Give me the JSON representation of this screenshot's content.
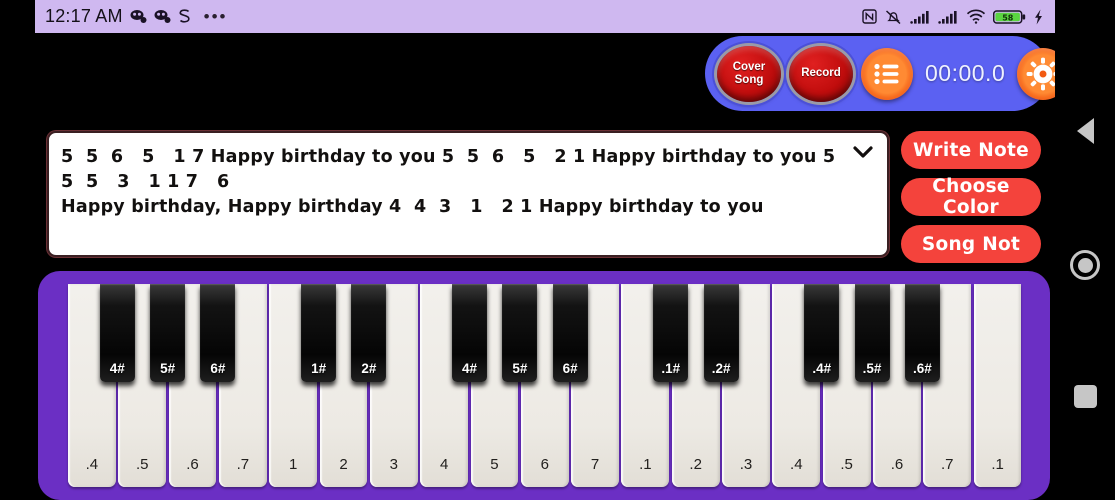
{
  "status_bar": {
    "clock": "12:17 AM",
    "left_icons": [
      "app-notification-icon",
      "app-notification-icon",
      "s-badge-icon",
      "more-dots-icon"
    ],
    "right_icons": [
      "nfc-icon",
      "mute-bell-icon",
      "signal-bars-icon",
      "signal-bars-icon",
      "wifi-icon",
      "battery-icon",
      "charging-bolt-icon"
    ],
    "battery_percent": "58",
    "bg_color": "#cfb8f0"
  },
  "toolbar": {
    "cover_song_label_line1": "Cover",
    "cover_song_label_line2": "Song",
    "record_label": "Record",
    "list_icon": "list-icon",
    "timer": "00:00.0",
    "gear_icon": "gear-icon",
    "bg_color": "#5b61f2",
    "button_color": "#c10d0d",
    "accent_color": "#ff8a33"
  },
  "note_box": {
    "text": "5  5  6   5   1 7 Happy birthday to you 5  5  6   5   2 1 Happy birthday to you 5  5  5   3   1 1 7   6\nHappy birthday, Happy birthday 4  4  3   1   2 1 Happy birthday to you",
    "chevron_icon": "chevron-down-icon",
    "border_color": "#3a1f22"
  },
  "actions": {
    "buttons": [
      {
        "label": "Write Note",
        "name": "write-note-button"
      },
      {
        "label": "Choose Color",
        "name": "choose-color-button"
      },
      {
        "label": "Song Not",
        "name": "song-not-button"
      }
    ],
    "color": "#f4433c"
  },
  "piano": {
    "frame_color": "#6b2fc4",
    "white_keys": [
      ".4",
      ".5",
      ".6",
      ".7",
      "1",
      "2",
      "3",
      "4",
      "5",
      "6",
      "7",
      ".1",
      ".2",
      ".3",
      ".4",
      ".5",
      ".6",
      ".7",
      ".1"
    ],
    "black_keys": [
      {
        "label": "4#",
        "after_white_index": 0
      },
      {
        "label": "5#",
        "after_white_index": 1
      },
      {
        "label": "6#",
        "after_white_index": 2
      },
      {
        "label": "1#",
        "after_white_index": 4
      },
      {
        "label": "2#",
        "after_white_index": 5
      },
      {
        "label": "4#",
        "after_white_index": 7
      },
      {
        "label": "5#",
        "after_white_index": 8
      },
      {
        "label": "6#",
        "after_white_index": 9
      },
      {
        "label": ".1#",
        "after_white_index": 11
      },
      {
        "label": ".2#",
        "after_white_index": 12
      },
      {
        "label": ".4#",
        "after_white_index": 14
      },
      {
        "label": ".5#",
        "after_white_index": 15
      },
      {
        "label": ".6#",
        "after_white_index": 16
      }
    ]
  },
  "nav_bar": {
    "back_icon": "back-triangle-icon",
    "home_icon": "home-circle-icon",
    "recent_icon": "recent-apps-square-icon"
  }
}
